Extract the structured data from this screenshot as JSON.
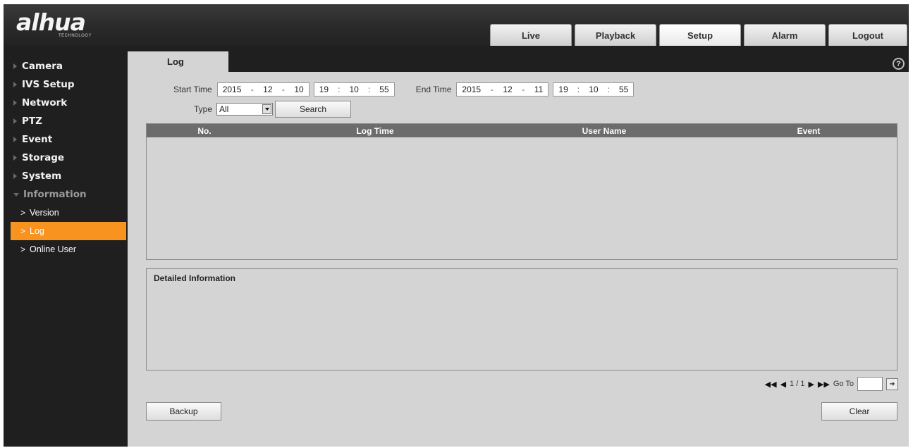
{
  "header": {
    "logo_text": "alhua",
    "logo_tagline": "TECHNOLOGY",
    "tabs": [
      {
        "label": "Live"
      },
      {
        "label": "Playback"
      },
      {
        "label": "Setup"
      },
      {
        "label": "Alarm"
      },
      {
        "label": "Logout"
      }
    ],
    "active_tab": "Setup"
  },
  "sidebar": {
    "items": [
      {
        "label": "Camera"
      },
      {
        "label": "IVS Setup"
      },
      {
        "label": "Network"
      },
      {
        "label": "PTZ"
      },
      {
        "label": "Event"
      },
      {
        "label": "Storage"
      },
      {
        "label": "System"
      },
      {
        "label": "Information"
      }
    ],
    "sub_items": [
      {
        "label": "Version"
      },
      {
        "label": "Log"
      },
      {
        "label": "Online User"
      }
    ],
    "active_sub_item": "Log",
    "active_color": "#f7931e"
  },
  "page": {
    "tab_label": "Log",
    "help_glyph": "?"
  },
  "filters": {
    "start_time_label": "Start Time",
    "start_year": "2015",
    "start_month": "12",
    "start_day": "10",
    "start_hour": "19",
    "start_minute": "10",
    "start_second": "55",
    "end_time_label": "End Time",
    "end_year": "2015",
    "end_month": "12",
    "end_day": "11",
    "end_hour": "19",
    "end_minute": "10",
    "end_second": "55",
    "date_sep": "-",
    "time_sep": ":",
    "type_label": "Type",
    "type_value": "All",
    "search_label": "Search"
  },
  "table": {
    "columns": [
      "No.",
      "Log Time",
      "User Name",
      "Event"
    ],
    "rows": []
  },
  "detail": {
    "title": "Detailed Information"
  },
  "pager": {
    "page_text": "1 / 1",
    "goto_label": "Go To",
    "goto_value": ""
  },
  "actions": {
    "backup_label": "Backup",
    "clear_label": "Clear"
  }
}
